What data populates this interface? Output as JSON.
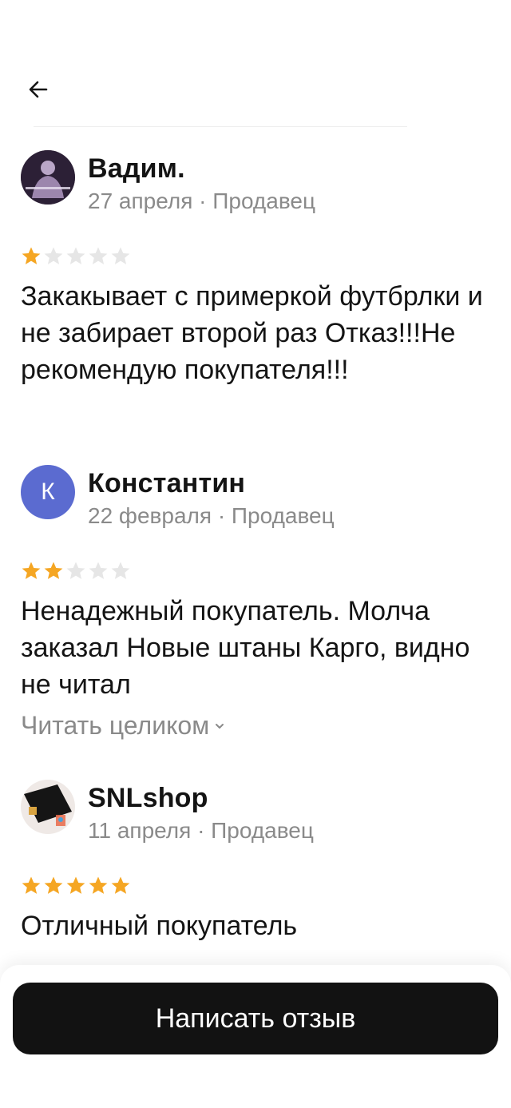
{
  "reviews": [
    {
      "author": "Вадим.",
      "avatar_type": "photo",
      "meta": "27 апреля · Продавец",
      "rating": 1,
      "text": "Закакывает с примеркой футбрлки и не забирает второй раз Отказ!!!Не рекомендую покупателя!!!"
    },
    {
      "author": "Константин",
      "avatar_type": "letter",
      "avatar_letter": "К",
      "meta": "22 февраля · Продавец",
      "rating": 2,
      "text": "Ненадежный покупатель. Молча заказал Новые штаны Карго, видно не читал",
      "read_more": "Читать целиком"
    },
    {
      "author": "SNLshop",
      "avatar_type": "photo",
      "meta": "11 апреля · Продавец",
      "rating": 5,
      "text": "Отличный покупатель"
    }
  ],
  "actions": {
    "write_review": "Написать отзыв"
  },
  "colors": {
    "star_active": "#f5a623",
    "star_inactive": "#e6e6e6",
    "avatar_letter_bg": "#5b6bd0",
    "button_bg": "#121212"
  },
  "icons": {
    "back": "arrow-left-icon",
    "star": "star-icon",
    "chevron": "chevron-down-icon"
  }
}
